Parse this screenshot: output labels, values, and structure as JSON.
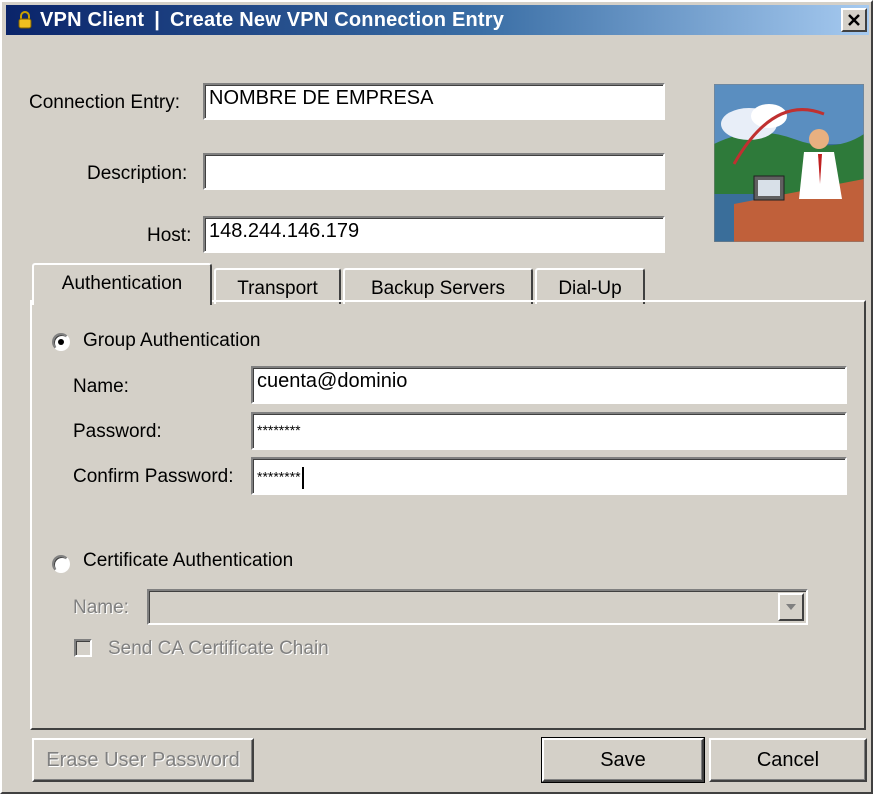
{
  "window": {
    "app_name": "VPN Client",
    "separator": "|",
    "title": "Create New VPN Connection Entry",
    "close_glyph": "✕"
  },
  "form": {
    "connection_entry": {
      "label": "Connection Entry:",
      "value": "NOMBRE DE EMPRESA"
    },
    "description": {
      "label": "Description:",
      "value": ""
    },
    "host": {
      "label": "Host:",
      "value": "148.244.146.179"
    }
  },
  "tabs": [
    {
      "label": "Authentication",
      "active": true
    },
    {
      "label": "Transport",
      "active": false
    },
    {
      "label": "Backup Servers",
      "active": false
    },
    {
      "label": "Dial-Up",
      "active": false
    }
  ],
  "authentication": {
    "group": {
      "label": "Group Authentication",
      "selected": true,
      "name": {
        "label": "Name:",
        "value": "cuenta@dominio"
      },
      "password": {
        "label": "Password:",
        "value": "********"
      },
      "confirm_password": {
        "label": "Confirm Password:",
        "value": "********"
      }
    },
    "certificate": {
      "label": "Certificate Authentication",
      "selected": false,
      "name": {
        "label": "Name:",
        "value": ""
      },
      "send_ca_chain": {
        "label": "Send CA Certificate Chain",
        "checked": false
      }
    }
  },
  "buttons": {
    "erase": "Erase User Password",
    "save": "Save",
    "cancel": "Cancel"
  },
  "icons": {
    "app": "lock-icon",
    "close": "close-icon",
    "dropdown": "dropdown-arrow-icon"
  }
}
